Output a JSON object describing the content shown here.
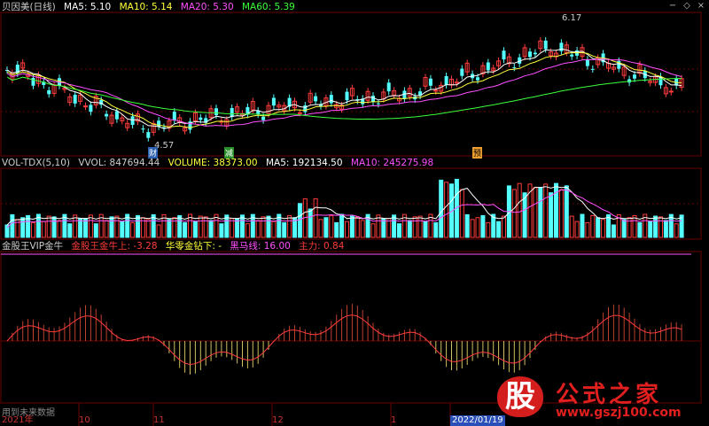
{
  "header_main": {
    "stock": "贝因美(日线)",
    "ma5": "MA5: 5.10",
    "ma10": "MA10: 5.14",
    "ma20": "MA20: 5.30",
    "ma60": "MA60: 5.39"
  },
  "header_vol": {
    "name": "VOL-TDX(5,10)",
    "vvol": "VVOL: 847694.44",
    "volume": "VOLUME: 38373.00",
    "ma5": "MA5: 192134.50",
    "ma10": "MA10: 245275.98"
  },
  "header_ind": {
    "name": "金股王VIP金牛",
    "l1": "金股王金牛上: -3.28",
    "l2": "华零金钻下: -",
    "l3": "黑马线: 16.00",
    "l4": "主力: 0.84"
  },
  "markers": {
    "high": "6.17",
    "low": "4.57",
    "m_cai": "财",
    "m_jian": "减",
    "m_yu": "预"
  },
  "footer": {
    "note": "用到未来数据",
    "d1": "2021年",
    "d2": "10",
    "d3": "11",
    "d4": "12",
    "d5": "1",
    "d6": "2022/01/19"
  },
  "watermark": {
    "badge": "股",
    "title": "公式之家",
    "url": "www.gszj100.com"
  },
  "colors": {
    "up": "#ff3c3c",
    "down": "#54ffff",
    "ma5": "#ffffff",
    "ma10": "#ffff3c",
    "ma20": "#ff50ff",
    "ma60": "#3cff3c",
    "grid": "#6a0000"
  },
  "controls": [
    "minus-icon",
    "plus-icon",
    "close-icon"
  ]
}
